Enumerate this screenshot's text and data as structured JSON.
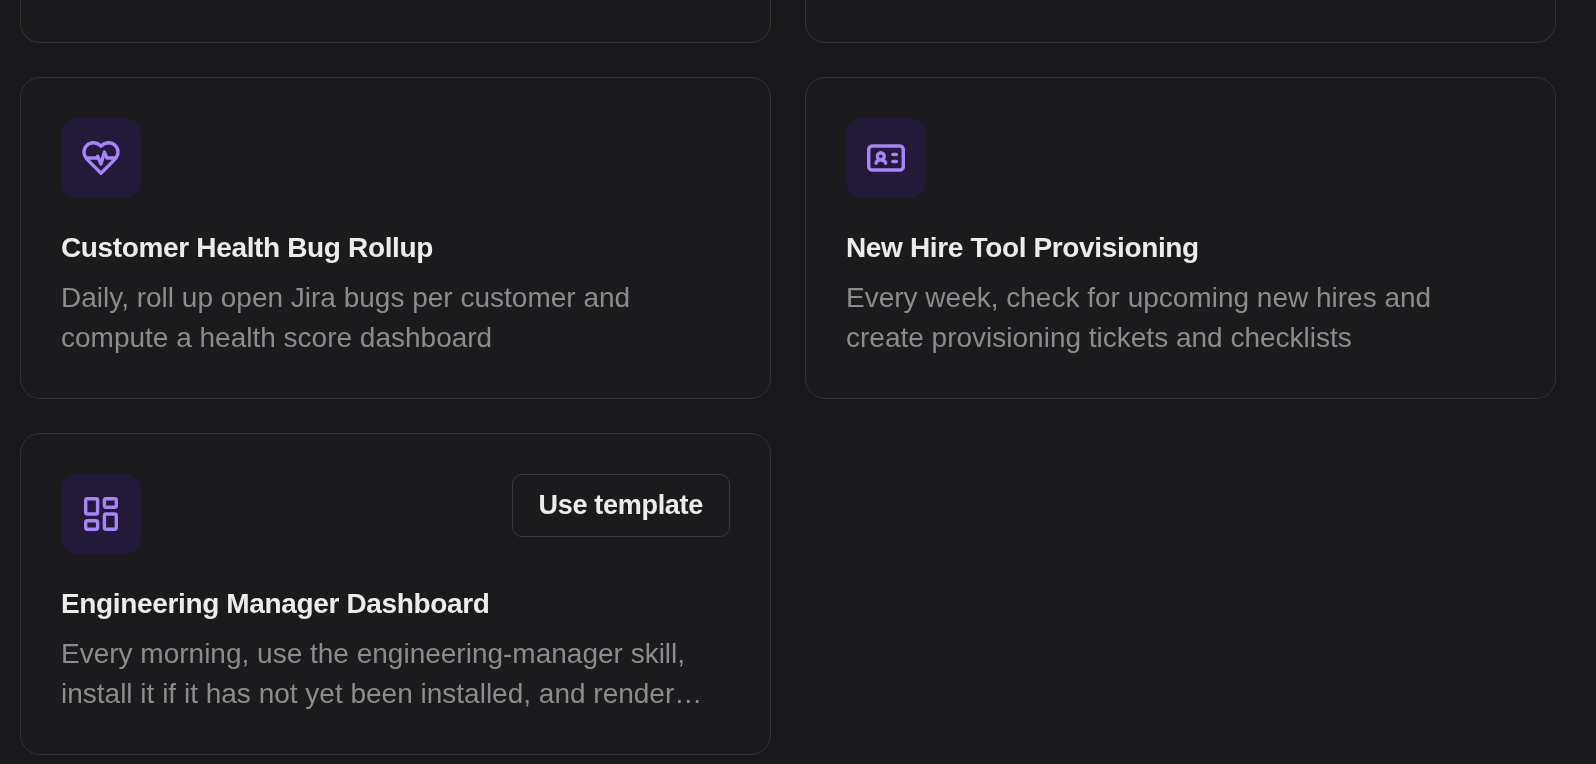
{
  "cards": [
    {
      "kind": "clipped"
    },
    {
      "kind": "clipped"
    },
    {
      "kind": "template",
      "title": "Customer Health Bug Rollup",
      "description": "Daily, roll up open Jira bugs per customer and compute a health score dashboard"
    },
    {
      "kind": "template",
      "title": "New Hire Tool Provisioning",
      "description": "Every week, check for upcoming new hires and create provisioning tickets and checklists"
    },
    {
      "kind": "template",
      "title": "Engineering Manager Dashboard",
      "description": "Every morning, use the engineering-manager skill, install it if it has not yet been installed, and render…",
      "button": "Use template"
    }
  ]
}
